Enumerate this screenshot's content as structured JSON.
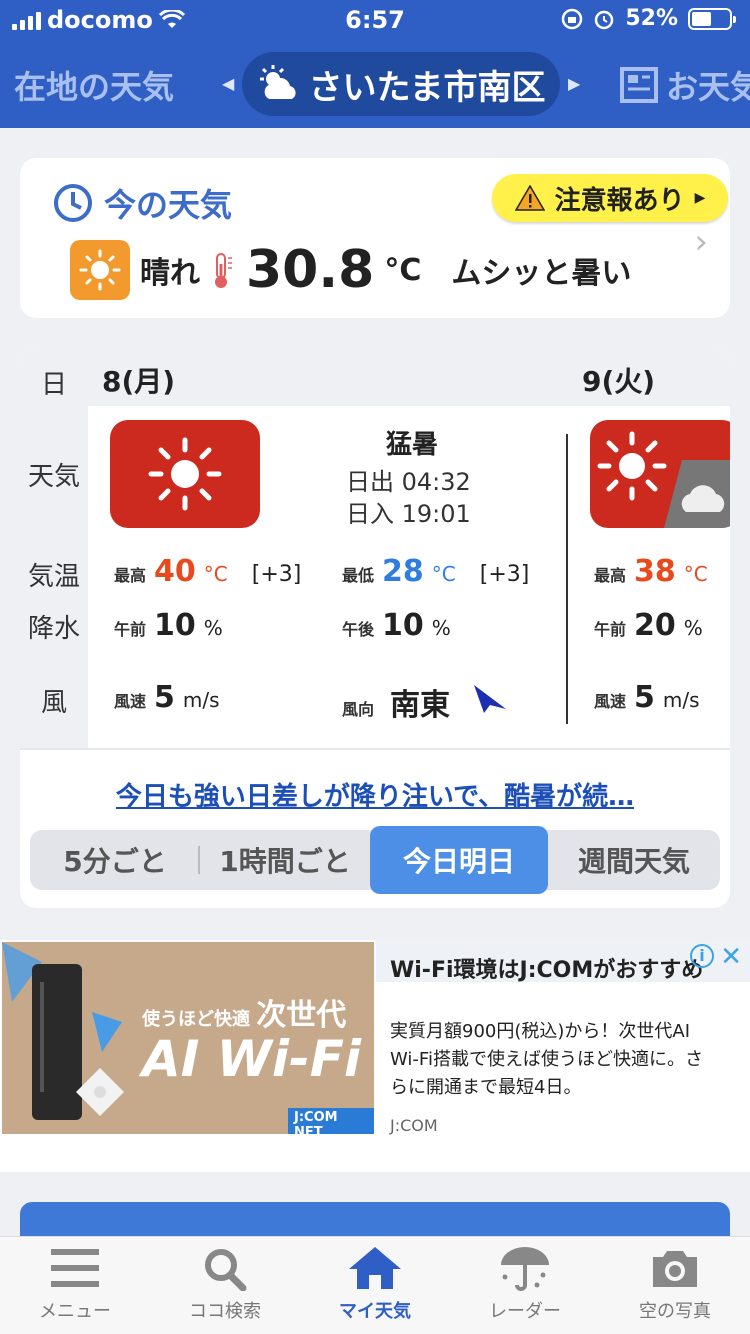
{
  "status_bar": {
    "carrier": "docomo",
    "time": "6:57",
    "battery": "52%"
  },
  "header": {
    "prev_tab": "在地の天気",
    "location": "さいたま市南区",
    "next_tab": "お天気"
  },
  "now": {
    "title": "今の天気",
    "alert": "注意報あり",
    "condition": "晴れ",
    "temperature": "30.8",
    "unit": "°C",
    "feeling": "ムシッと暑い"
  },
  "forecast": {
    "row_labels": {
      "day": "日",
      "weather": "天気",
      "temp": "気温",
      "precip": "降水",
      "wind": "風"
    },
    "today": {
      "date": "8(月)",
      "summary": "猛暑",
      "sunrise_label": "日出",
      "sunrise": "04:32",
      "sunset_label": "日入",
      "sunset": "19:01",
      "max_label": "最高",
      "max": "40",
      "max_diff": "[+3]",
      "min_label": "最低",
      "min": "28",
      "min_diff": "[+3]",
      "am_label": "午前",
      "am": "10",
      "pm_label": "午後",
      "pm": "10",
      "wind_speed_label": "風速",
      "wind_speed": "5",
      "wind_dir_label": "風向",
      "wind_dir": "南東"
    },
    "tomorrow": {
      "date": "9(火)",
      "max_label": "最高",
      "max": "38",
      "am_label": "午前",
      "am": "20",
      "wind_speed_label": "風速",
      "wind_speed": "5"
    },
    "temp_unit": "°C",
    "pct_unit": "%",
    "wind_unit": "m/s",
    "message": "今日も強い日差しが降り注いで、酷暑が続…",
    "segments": [
      "5分ごと",
      "1時間ごと",
      "今日明日",
      "週間天気"
    ],
    "active_segment": "今日明日"
  },
  "ad": {
    "image_tagline": "使うほど快適",
    "image_title_jp": "次世代",
    "image_title": "AI Wi-Fi",
    "image_badge": "J:COM NET",
    "headline": "Wi-Fi環境はJ:COMがおすすめ",
    "body": "実質月額900円(税込)から！次世代AI Wi-Fi搭載で使えば使うほど快適に。さらに開通まで最短4日。",
    "brand": "J:COM",
    "info_icon": "i"
  },
  "tabbar": {
    "items": [
      {
        "label": "メニュー",
        "icon": "menu-icon"
      },
      {
        "label": "ココ検索",
        "icon": "search-icon"
      },
      {
        "label": "マイ天気",
        "icon": "home-icon"
      },
      {
        "label": "レーダー",
        "icon": "umbrella-icon"
      },
      {
        "label": "空の写真",
        "icon": "camera-icon"
      }
    ],
    "active": "マイ天気"
  },
  "colors": {
    "header": "#2f5fc4",
    "accent": "#3d6cc9",
    "max_temp": "#e8491d",
    "min_temp": "#2f7de0",
    "weather_box": "#cc2a1e"
  }
}
